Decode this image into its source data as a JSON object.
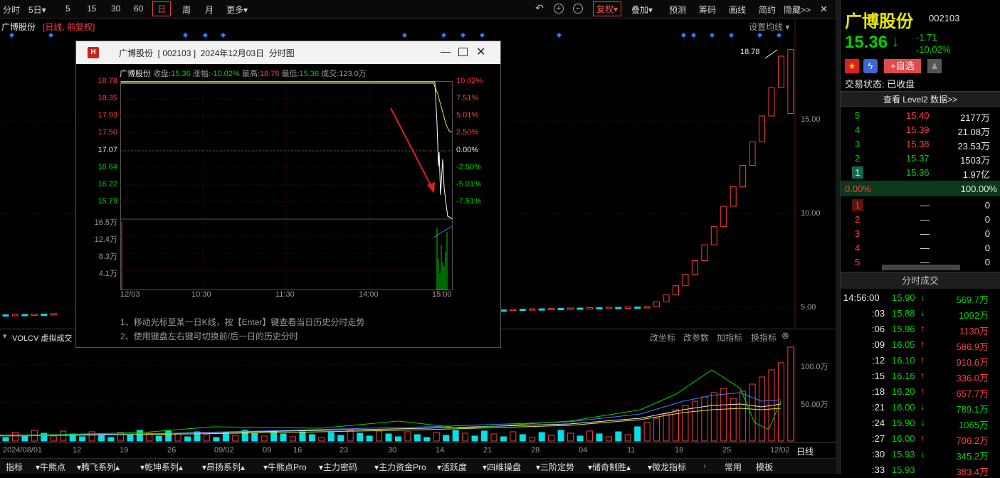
{
  "toolbar": {
    "items": [
      "分时",
      "5日▾",
      "5",
      "15",
      "30",
      "60",
      "日",
      "周",
      "月",
      "更多▾"
    ],
    "right": [
      "复权▾",
      "叠加▾",
      "预测",
      "筹码",
      "画线",
      "简约",
      "隐藏>>"
    ]
  },
  "chart_header": {
    "name": "广博股份",
    "tags": "[日线, 前复权]",
    "setting": "设置均线 ▾",
    "high_label": "18.78"
  },
  "price_axis": [
    "15.00",
    "10.00",
    "5.00"
  ],
  "popup": {
    "title": "广博股份  [ 002103 ]  2024年12月03日  分时图",
    "info": {
      "name": "广博股份",
      "close_label": "收盘:",
      "close": "15.36",
      "chg_label": "涨幅:",
      "chg": "-10.02%",
      "high_label": "最高:",
      "high": "18.78",
      "low_label": "最低:",
      "low": "15.36",
      "vol_label": "成交:",
      "vol": "123.0万"
    },
    "left_prices": [
      "18.78",
      "18.35",
      "17.93",
      "17.50",
      "17.07",
      "16.64",
      "16.22",
      "15.79"
    ],
    "right_pcts": [
      "10.02%",
      "7.51%",
      "5.01%",
      "2.50%",
      "0.00%",
      "-2.50%",
      "-5.01%",
      "-7.51%"
    ],
    "vol_labels": [
      "16.5万",
      "12.4万",
      "8.3万",
      "4.1万"
    ],
    "times": [
      "12/03",
      "10:30",
      "11:30",
      "14:00",
      "15:00"
    ],
    "tips": [
      "1、移动光标至某一日K线，按【Enter】键查看当日历史分时走势",
      "2、使用键盘左右键可切换前/后一日的历史分时"
    ]
  },
  "volume_panel": {
    "title": "VOLCV 虚拟成交",
    "actions": [
      "改坐标",
      "改参数",
      "加指标",
      "换指标"
    ],
    "axis": [
      "100.0万",
      "50.00万"
    ]
  },
  "dates": [
    "2024/08/01",
    "12",
    "19",
    "26",
    "09/02",
    "09",
    "16",
    "23",
    "30",
    "14",
    "21",
    "28",
    "04",
    "11",
    "18",
    "25",
    "12/02"
  ],
  "dates_suffix": "日线",
  "bottom_tabs": [
    "指标",
    "▾牛熊点",
    "▾腾飞系列▴",
    "▾乾坤系列▴",
    "▾昂扬系列▴",
    "▾牛熊点Pro",
    "▾主力密码",
    "▾主力资金Pro",
    "▾活跃度",
    "▾四维操盘",
    "▾三阶定势",
    "▾储奇制胜▴",
    "▾微龙指标",
    "常用",
    "模板"
  ],
  "quote": {
    "name": "广博股份",
    "code": "002103",
    "price": "15.36",
    "arrow": "↓",
    "change": "-1.71",
    "pct": "-10.02%",
    "watch": "+自选",
    "status": "交易状态: 已收盘",
    "level2": "查看 Level2 数据>>"
  },
  "sells": [
    {
      "lv": "5",
      "p": "15.40",
      "v": "2177万"
    },
    {
      "lv": "4",
      "p": "15.39",
      "v": "21.08万"
    },
    {
      "lv": "3",
      "p": "15.38",
      "v": "23.53万"
    },
    {
      "lv": "2",
      "p": "15.37",
      "v": "1503万"
    },
    {
      "lv": "1",
      "p": "15.36",
      "v": "1.97亿"
    }
  ],
  "ratio": {
    "left": "0.00%",
    "right": "100.00%"
  },
  "buys": [
    {
      "lv": "1",
      "p": "—",
      "v": "0"
    },
    {
      "lv": "2",
      "p": "—",
      "v": "0"
    },
    {
      "lv": "3",
      "p": "—",
      "v": "0"
    },
    {
      "lv": "4",
      "p": "—",
      "v": "0"
    },
    {
      "lv": "5",
      "p": "—",
      "v": "0"
    }
  ],
  "trades_title": "分时成交",
  "trades": [
    {
      "t": "14:56:00",
      "p": "15.90",
      "d": "↓",
      "v": "569.7万",
      "c": "g"
    },
    {
      "t": ":03",
      "p": "15.88",
      "d": "↓",
      "v": "1092万",
      "c": "g"
    },
    {
      "t": ":06",
      "p": "15.96",
      "d": "↑",
      "v": "1130万",
      "c": "r"
    },
    {
      "t": ":09",
      "p": "16.05",
      "d": "↑",
      "v": "586.9万",
      "c": "r"
    },
    {
      "t": ":12",
      "p": "16.10",
      "d": "↑",
      "v": "910.6万",
      "c": "r"
    },
    {
      "t": ":15",
      "p": "16.16",
      "d": "↑",
      "v": "336.0万",
      "c": "r"
    },
    {
      "t": ":18",
      "p": "16.20",
      "d": "↑",
      "v": "657.7万",
      "c": "r"
    },
    {
      "t": ":21",
      "p": "16.00",
      "d": "↓",
      "v": "789.1万",
      "c": "g"
    },
    {
      "t": ":24",
      "p": "15.90",
      "d": "↓",
      "v": "1065万",
      "c": "g"
    },
    {
      "t": ":27",
      "p": "16.00",
      "d": "↑",
      "v": "706.2万",
      "c": "r"
    },
    {
      "t": ":30",
      "p": "15.93",
      "d": "↓",
      "v": "345.2万",
      "c": "g"
    },
    {
      "t": ":33",
      "p": "15.93",
      "d": "",
      "v": "383.4万",
      "c": "r"
    }
  ]
}
